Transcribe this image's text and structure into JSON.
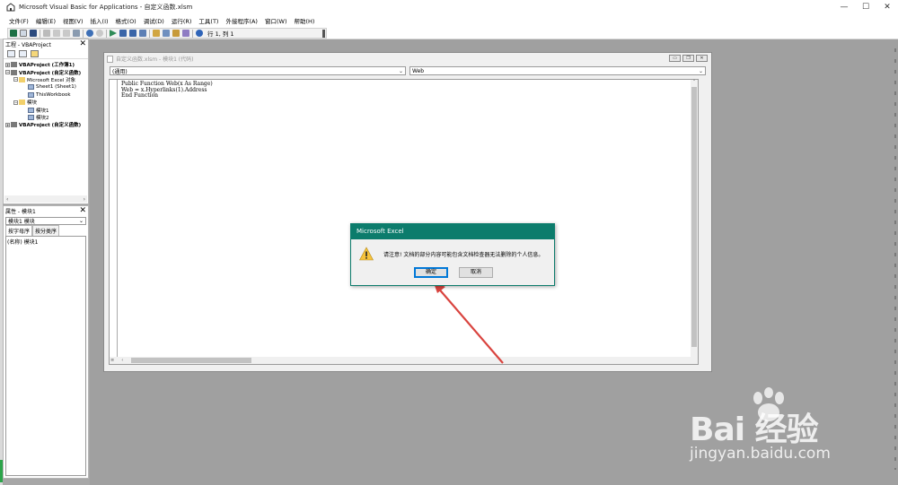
{
  "window": {
    "title": "Microsoft Visual Basic for Applications - 自定义函数.xlsm",
    "controls": [
      "—",
      "☐",
      "✕"
    ]
  },
  "menu": [
    "文件(F)",
    "编辑(E)",
    "视图(V)",
    "插入(I)",
    "格式(O)",
    "调试(D)",
    "运行(R)",
    "工具(T)",
    "外接程序(A)",
    "窗口(W)",
    "帮助(H)"
  ],
  "toolbar": {
    "position_text": "行 1, 列 1"
  },
  "project_pane": {
    "title": "工程 - VBAProject",
    "tree": [
      {
        "label": "VBAProject (工作簿1)",
        "expander": "+",
        "indent": 0,
        "bold": true
      },
      {
        "label": "VBAProject (自定义函数)",
        "expander": "−",
        "indent": 0,
        "bold": true
      },
      {
        "label": "Microsoft Excel 对象",
        "expander": "−",
        "indent": 1,
        "bold": false
      },
      {
        "label": "Sheet1 (Sheet1)",
        "expander": "",
        "indent": 2,
        "bold": false
      },
      {
        "label": "ThisWorkbook",
        "expander": "",
        "indent": 2,
        "bold": false
      },
      {
        "label": "模块",
        "expander": "−",
        "indent": 1,
        "bold": false
      },
      {
        "label": "模块1",
        "expander": "",
        "indent": 2,
        "bold": false
      },
      {
        "label": "模块2",
        "expander": "",
        "indent": 2,
        "bold": false
      },
      {
        "label": "VBAProject (自定义函数)",
        "expander": "+",
        "indent": 0,
        "bold": true
      }
    ]
  },
  "props_pane": {
    "title": "属性 - 模块1",
    "selected": "模块1 模块",
    "tabs": [
      "按字母序",
      "按分类序"
    ],
    "row": "(名称) 模块1"
  },
  "code_window": {
    "title": "自定义函数.xlsm - 模块1 (代码)",
    "object_combo": "(通用)",
    "proc_combo": "Web",
    "code": "Public Function Web(x As Range)\nWeb = x.Hyperlinks(1).Address\nEnd Function"
  },
  "dialog": {
    "title": "Microsoft Excel",
    "message": "请注意! 文档的部分内容可能包含文档检查器无法删除的个人信息。",
    "ok_label": "确定",
    "cancel_label": "取消"
  },
  "watermark": {
    "brand": "Bai 经验",
    "url": "jingyan.baidu.com"
  },
  "colors": {
    "dialog_accent": "#0c7c6c",
    "arrow": "#d9443f",
    "default_button_border": "#0078d7"
  }
}
